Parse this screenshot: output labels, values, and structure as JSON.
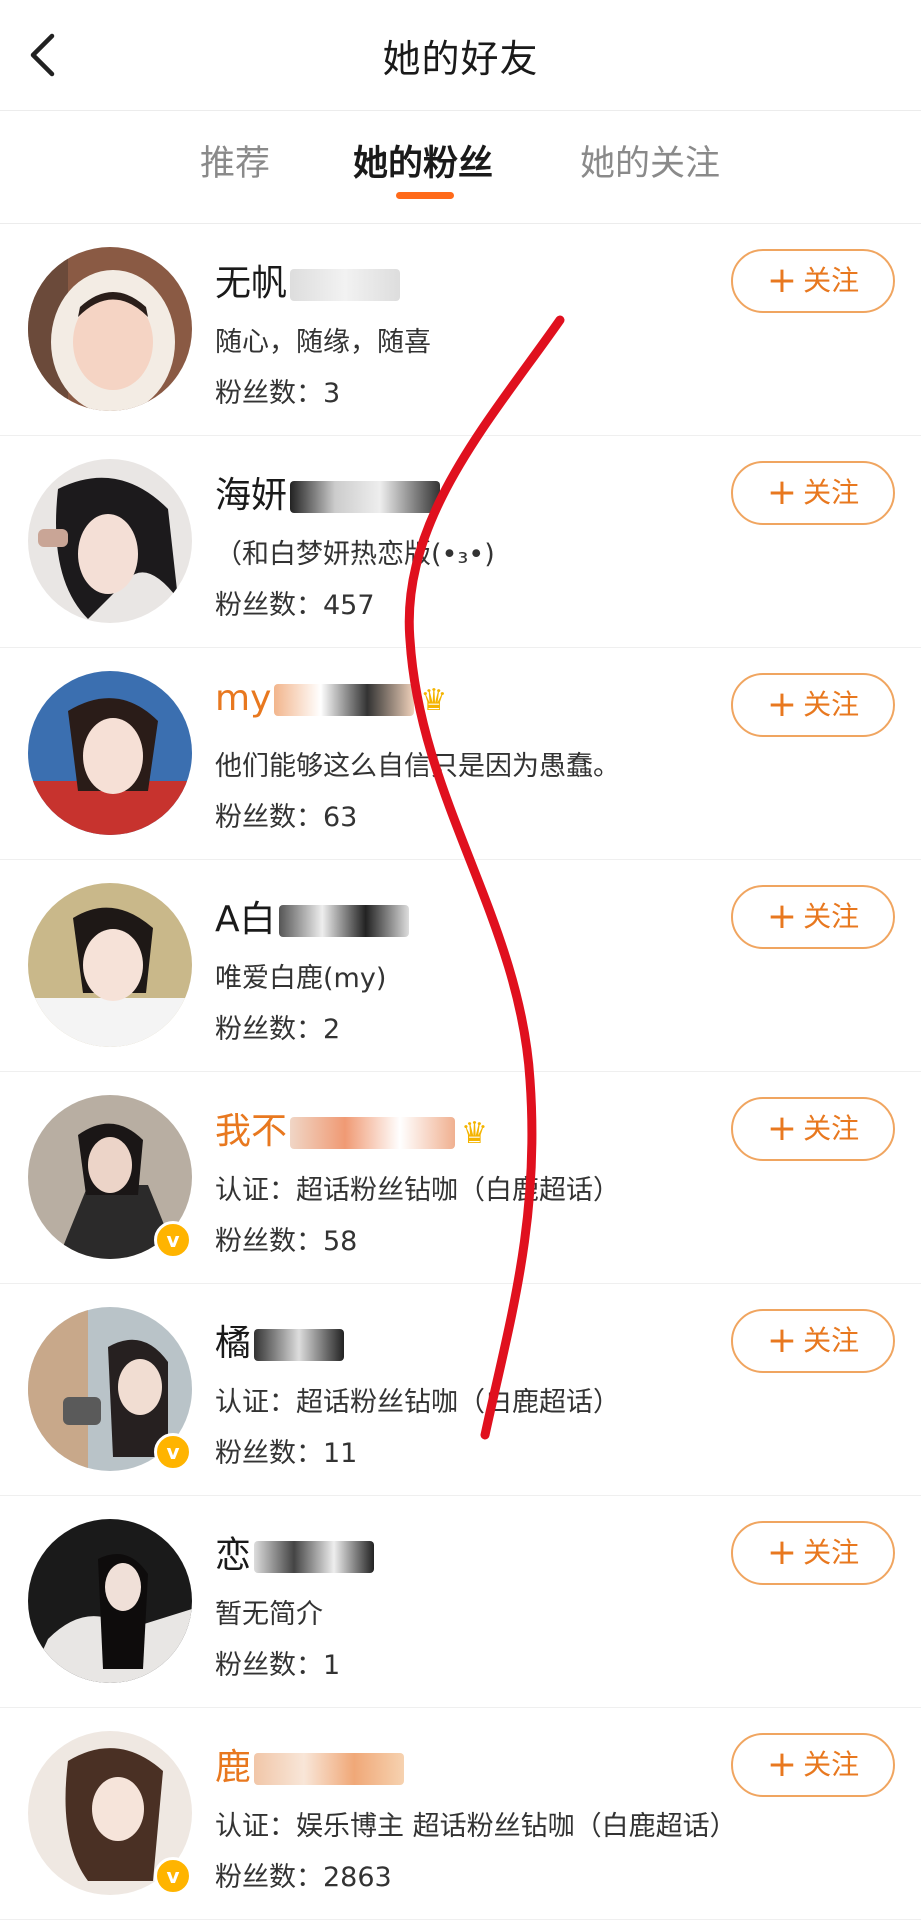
{
  "header": {
    "title": "她的好友"
  },
  "tabs": [
    {
      "label": "推荐",
      "active": false
    },
    {
      "label": "她的粉丝",
      "active": true
    },
    {
      "label": "她的关注",
      "active": false
    }
  ],
  "colors": {
    "accent": "#ff6a1a",
    "follow_text": "#e8781f",
    "follow_border": "#f0a560",
    "vip_name": "#e8781f",
    "verified_badge": "#ffb400",
    "annotation_line": "#e0101e"
  },
  "follow_label": "关注",
  "users": [
    {
      "name": "无帆",
      "bio": "随心，随缘，随喜",
      "fans": "粉丝数：3",
      "vip": false,
      "verified": false
    },
    {
      "name": "海妍",
      "bio": "（和白梦妍热恋版(•₃•)",
      "fans": "粉丝数：457",
      "vip": false,
      "verified": false
    },
    {
      "name": "my",
      "bio": "他们能够这么自信只是因为愚蠢。",
      "fans": "粉丝数：63",
      "vip": true,
      "verified": false
    },
    {
      "name": "A白",
      "bio": "唯爱白鹿(my)",
      "fans": "粉丝数：2",
      "vip": false,
      "verified": false
    },
    {
      "name": "我不",
      "bio": "认证：超话粉丝钻咖（白鹿超话）",
      "fans": "粉丝数：58",
      "vip": true,
      "verified": true
    },
    {
      "name": "橘",
      "bio": "认证：超话粉丝钻咖（白鹿超话）",
      "fans": "粉丝数：11",
      "vip": false,
      "verified": true
    },
    {
      "name": "恋",
      "bio": "暂无简介",
      "fans": "粉丝数：1",
      "vip": false,
      "verified": false
    },
    {
      "name": "鹿",
      "bio": "认证：娱乐博主 超话粉丝钻咖（白鹿超话）",
      "fans": "粉丝数：2863",
      "vip": true,
      "verified": true
    }
  ]
}
